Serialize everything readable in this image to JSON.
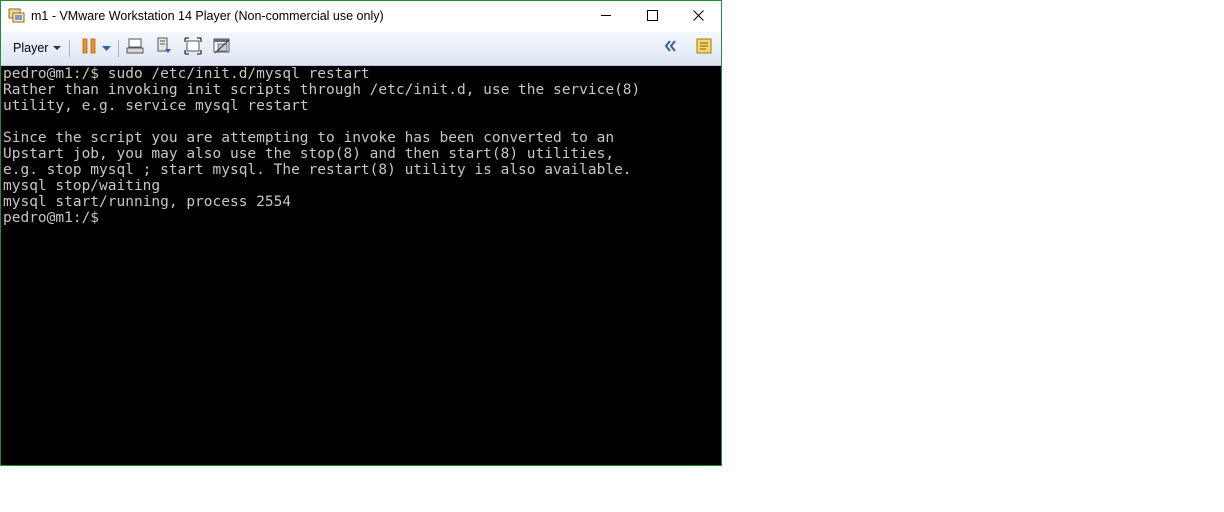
{
  "window": {
    "title": "m1 - VMware Workstation 14 Player (Non-commercial use only)",
    "app_icon": "vmware-player-icon"
  },
  "titlebar_buttons": {
    "minimize": "minimize-icon",
    "maximize": "maximize-icon",
    "close": "close-icon"
  },
  "toolbar": {
    "player_label": "Player",
    "buttons": [
      "pause-icon",
      "pause-dropdown-icon",
      "send-ctrl-alt-del-icon",
      "removable-devices-icon",
      "full-screen-icon",
      "unity-icon",
      "collapse-library-icon",
      "message-log-icon"
    ]
  },
  "terminal": {
    "lines": [
      "pedro@m1:/$ sudo /etc/init.d/mysql restart",
      "Rather than invoking init scripts through /etc/init.d, use the service(8)",
      "utility, e.g. service mysql restart",
      "",
      "Since the script you are attempting to invoke has been converted to an",
      "Upstart job, you may also use the stop(8) and then start(8) utilities,",
      "e.g. stop mysql ; start mysql. The restart(8) utility is also available.",
      "mysql stop/waiting",
      "mysql start/running, process 2554",
      "pedro@m1:/$"
    ]
  },
  "colors": {
    "terminal_bg": "#000000",
    "terminal_fg": "#c6c6c6",
    "window_border": "#1e8c3a",
    "pause_accent": "#e8912c",
    "toolbar_accent": "#2f5fae"
  }
}
